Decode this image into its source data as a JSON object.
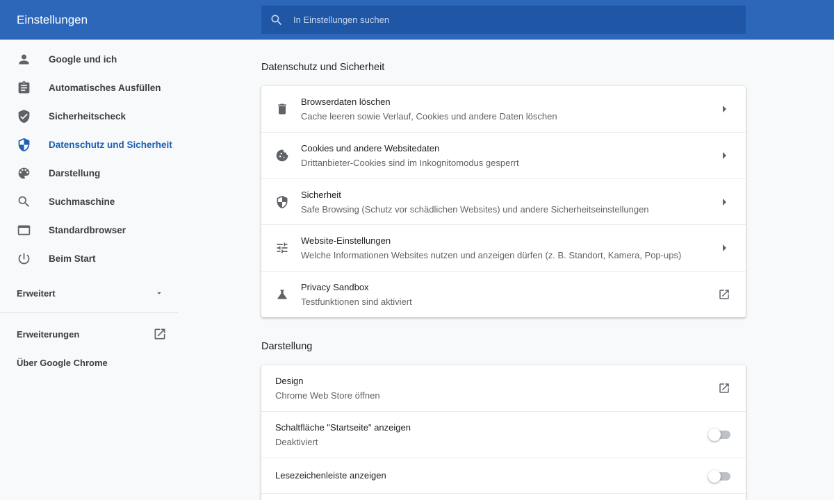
{
  "header": {
    "title": "Einstellungen",
    "search_placeholder": "In Einstellungen suchen",
    "bar_color": "#2c67b9"
  },
  "sidebar": {
    "items": [
      {
        "label": "Google und ich",
        "icon": "person-icon"
      },
      {
        "label": "Automatisches Ausfüllen",
        "icon": "clipboard-icon"
      },
      {
        "label": "Sicherheitscheck",
        "icon": "shield-check-icon"
      },
      {
        "label": "Datenschutz und Sicherheit",
        "icon": "shield-icon",
        "active": true
      },
      {
        "label": "Darstellung",
        "icon": "palette-icon"
      },
      {
        "label": "Suchmaschine",
        "icon": "search-icon"
      },
      {
        "label": "Standardbrowser",
        "icon": "browser-window-icon"
      },
      {
        "label": "Beim Start",
        "icon": "power-icon"
      }
    ],
    "advanced_label": "Erweitert",
    "extensions_label": "Erweiterungen",
    "about_label": "Über Google Chrome",
    "accent_color": "#1a5fb4"
  },
  "privacy": {
    "section_title": "Datenschutz und Sicherheit",
    "rows": [
      {
        "title": "Browserdaten löschen",
        "subtitle": "Cache leeren sowie Verlauf, Cookies und andere Daten löschen",
        "icon": "trash-icon"
      },
      {
        "title": "Cookies und andere Websitedaten",
        "subtitle": "Drittanbieter-Cookies sind im Inkognitomodus gesperrt",
        "icon": "cookie-icon"
      },
      {
        "title": "Sicherheit",
        "subtitle": "Safe Browsing (Schutz vor schädlichen Websites) und andere Sicherheitseinstellungen",
        "icon": "shield-icon"
      },
      {
        "title": "Website-Einstellungen",
        "subtitle": "Welche Informationen Websites nutzen und anzeigen dürfen (z. B. Standort, Kamera, Pop-ups)",
        "icon": "sliders-icon"
      },
      {
        "title": "Privacy Sandbox",
        "subtitle": "Testfunktionen sind aktiviert",
        "icon": "flask-icon"
      }
    ]
  },
  "appearance": {
    "section_title": "Darstellung",
    "design_title": "Design",
    "design_subtitle": "Chrome Web Store öffnen",
    "home_button_title": "Schaltfläche \"Startseite\" anzeigen",
    "home_button_subtitle": "Deaktiviert",
    "home_button_on": false,
    "bookmarks_bar_title": "Lesezeichenleiste anzeigen",
    "bookmarks_bar_on": false
  }
}
